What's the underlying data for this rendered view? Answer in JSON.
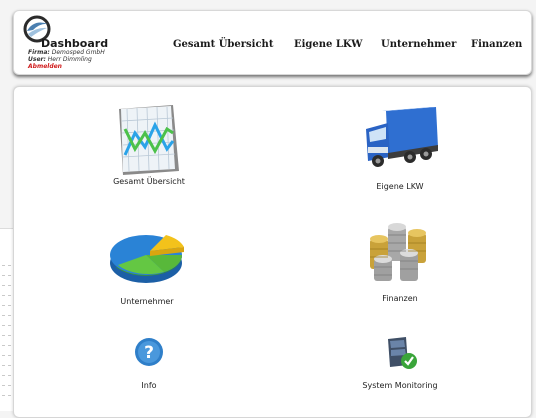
{
  "header": {
    "brand": "Dashboard",
    "firma_label": "Firma:",
    "firma_value": "Demosped GmbH",
    "user_label": "User:",
    "user_value": "Herr Dimmling",
    "logout": "Abmelden",
    "nav": [
      "Gesamt Übersicht",
      "Eigene LKW",
      "Unternehmer",
      "Finanzen"
    ]
  },
  "tiles": [
    {
      "label": "Gesamt Übersicht",
      "icon": "line-chart-icon"
    },
    {
      "label": "Eigene LKW",
      "icon": "truck-icon"
    },
    {
      "label": "Unternehmer",
      "icon": "pie-chart-icon"
    },
    {
      "label": "Finanzen",
      "icon": "coins-icon"
    },
    {
      "label": "Info",
      "icon": "question-icon"
    },
    {
      "label": "System Monitoring",
      "icon": "server-check-icon"
    }
  ],
  "colors": {
    "accent_logout": "#d01c1c",
    "truck_blue": "#2f6fd1",
    "pie_blue": "#2a83d6",
    "pie_green": "#58b83a",
    "pie_yellow": "#f3c21b"
  }
}
